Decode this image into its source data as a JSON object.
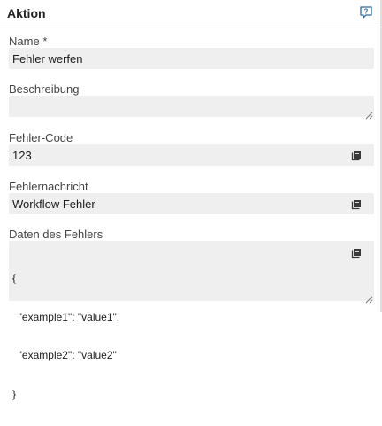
{
  "header": {
    "title": "Aktion",
    "help_icon": "help-icon"
  },
  "fields": {
    "name": {
      "label": "Name",
      "required_marker": "*",
      "value": "Fehler werfen"
    },
    "description": {
      "label": "Beschreibung",
      "value": ""
    },
    "error_code": {
      "label": "Fehler-Code",
      "value": "123",
      "icon": "book-icon"
    },
    "error_message": {
      "label": "Fehlernachricht",
      "value": "Workflow Fehler",
      "icon": "book-icon"
    },
    "error_data": {
      "label": "Daten des Fehlers",
      "lines": [
        "{",
        "  \"example1\": \"value1\",",
        "  \"example2\": \"value2\"",
        "}"
      ],
      "icon": "book-icon"
    }
  }
}
